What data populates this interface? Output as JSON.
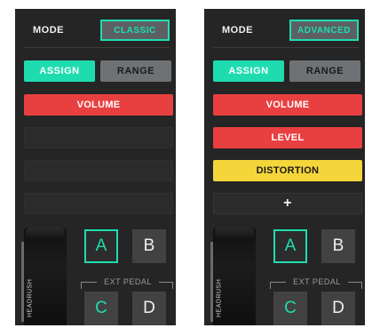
{
  "panels": [
    {
      "mode_label": "MODE",
      "mode_value": "CLASSIC",
      "tabs": {
        "assign": "ASSIGN",
        "range": "RANGE"
      },
      "slots": [
        {
          "label": "VOLUME",
          "color": "#e84040"
        },
        {
          "label": ""
        },
        {
          "label": ""
        },
        {
          "label": ""
        }
      ],
      "pedal_brand": "HEADRUSH",
      "footswitches": [
        "A",
        "B",
        "C",
        "D"
      ],
      "ext_pedal_label": "EXT PEDAL",
      "selected_footswitch": "A"
    },
    {
      "mode_label": "MODE",
      "mode_value": "ADVANCED",
      "tabs": {
        "assign": "ASSIGN",
        "range": "RANGE"
      },
      "slots": [
        {
          "label": "VOLUME",
          "color": "#e84040"
        },
        {
          "label": "LEVEL",
          "color": "#e84040"
        },
        {
          "label": "DISTORTION",
          "color": "#f5d63a"
        },
        {
          "label": "+"
        }
      ],
      "pedal_brand": "HEADRUSH",
      "footswitches": [
        "A",
        "B",
        "C",
        "D"
      ],
      "ext_pedal_label": "EXT PEDAL",
      "selected_footswitch": "A"
    }
  ],
  "colors": {
    "accent": "#1fdcb0",
    "red": "#e84040",
    "yellow": "#f5d63a",
    "panel_bg": "#252525"
  }
}
